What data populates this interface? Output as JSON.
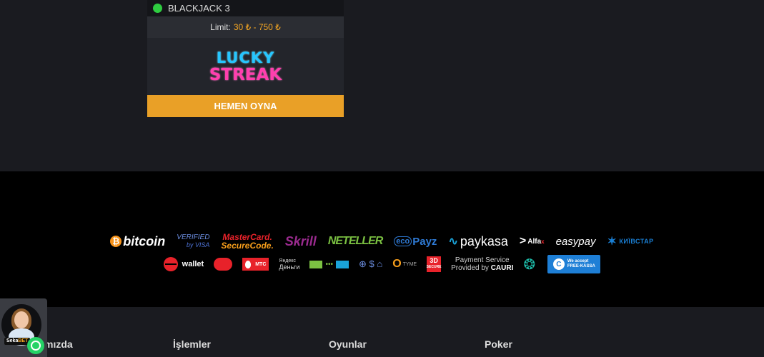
{
  "game_card": {
    "title": "BLACKJACK 3",
    "limit_label": "Limit:",
    "limit_value": "30 ₺ - 750 ₺",
    "provider_line1": "LUCKY",
    "provider_line2": "STREAK",
    "play_button": "HEMEN OYNA",
    "status_color": "#2ecc40",
    "accent_color": "#e9a027"
  },
  "payments": {
    "row1": {
      "bitcoin": "bitcoin",
      "verified_visa_1": "VERIFIED",
      "verified_visa_2": "by VISA",
      "mastercard_1": "MasterCard.",
      "mastercard_2": "SecureCode.",
      "skrill": "Skrill",
      "neteller": "NETELLER",
      "ecopayz_eco": "eco",
      "ecopayz_payz": "Payz",
      "paykasa": "paykasa",
      "alfa": "Alfa",
      "easypay": "easypay",
      "kyivstar": "КИЇВСТАР"
    },
    "row2": {
      "wallet": "wallet",
      "mts": "МТС",
      "yandex_1": "Яндекс",
      "yandex_2": "Деньги",
      "tyme": "TYME",
      "secure_3d": "3D",
      "secure_3d_sub": "SECURE",
      "cauri_line1": "Payment Service",
      "cauri_line2_prefix": "Provided by",
      "cauri_line2_brand": "CAURI",
      "freekassa_1": "We accept",
      "freekassa_2": "FREE-KASSA"
    }
  },
  "footer": {
    "col1": "mızda",
    "col2": "İşlemler",
    "col3": "Oyunlar",
    "col4": "Poker"
  },
  "support_widget": {
    "brand_prefix": "Seka",
    "brand_suffix": "BET"
  }
}
